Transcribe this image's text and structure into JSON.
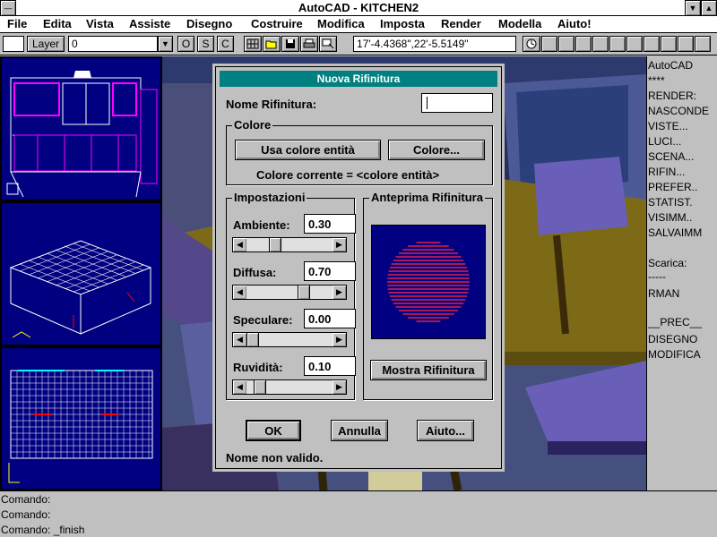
{
  "window": {
    "title": "AutoCAD - KITCHEN2",
    "control_glyph": "—",
    "minimize_glyph": "▼",
    "maximize_glyph": "▲"
  },
  "menu": [
    "File",
    "Edita",
    "Vista",
    "Assiste",
    "Disegno",
    "Costruire",
    "Modifica",
    "Imposta",
    "Render",
    "Modella",
    "Aiuto!"
  ],
  "toolbar": {
    "layer_label": "Layer",
    "layer_value": "0",
    "dropdown_glyph": "▼",
    "ortho": "O",
    "snap": "S",
    "coord_toggle": "C",
    "coordinates": "17'-4.4368\",22'-5.5149\""
  },
  "side_menu": [
    "AutoCAD",
    "****",
    "RENDER:",
    "NASCONDE",
    "VISTE...",
    "LUCI...",
    "SCENA...",
    "RIFIN...",
    "PREFER..",
    "STATIST.",
    "VISIMM..",
    "SALVAIMM",
    "",
    "Scarica:",
    "-----",
    "RMAN",
    "",
    "__PREC__",
    "DISEGNO",
    "MODIFICA"
  ],
  "command_lines": [
    "Comando:",
    "Comando:",
    "Comando: _finish"
  ],
  "dialog": {
    "title": "Nuova Rifinitura",
    "name_label": "Nome Rifinitura:",
    "name_value": "",
    "color_group": "Colore",
    "use_entity_color_button": "Usa colore entità",
    "color_button": "Colore...",
    "current_color_text": "Colore corrente = <colore entità>",
    "settings_group": "Impostazioni",
    "settings": [
      {
        "label": "Ambiente:",
        "value": "0.30",
        "fraction": 0.3
      },
      {
        "label": "Diffusa:",
        "value": "0.70",
        "fraction": 0.7
      },
      {
        "label": "Speculare:",
        "value": "0.00",
        "fraction": 0.0
      },
      {
        "label": "Ruvidità:",
        "value": "0.10",
        "fraction": 0.1
      }
    ],
    "preview_group": "Anteprima Rifinitura",
    "preview_button": "Mostra Rifinitura",
    "ok_button": "OK",
    "cancel_button": "Annulla",
    "help_button": "Aiuto...",
    "status": "Nome non valido.",
    "scroll_left_glyph": "◀",
    "scroll_right_glyph": "▶"
  },
  "colors": {
    "viewport_bg": "#000080",
    "dialog_title": "#008080",
    "preview_sphere": "#e0204a"
  }
}
